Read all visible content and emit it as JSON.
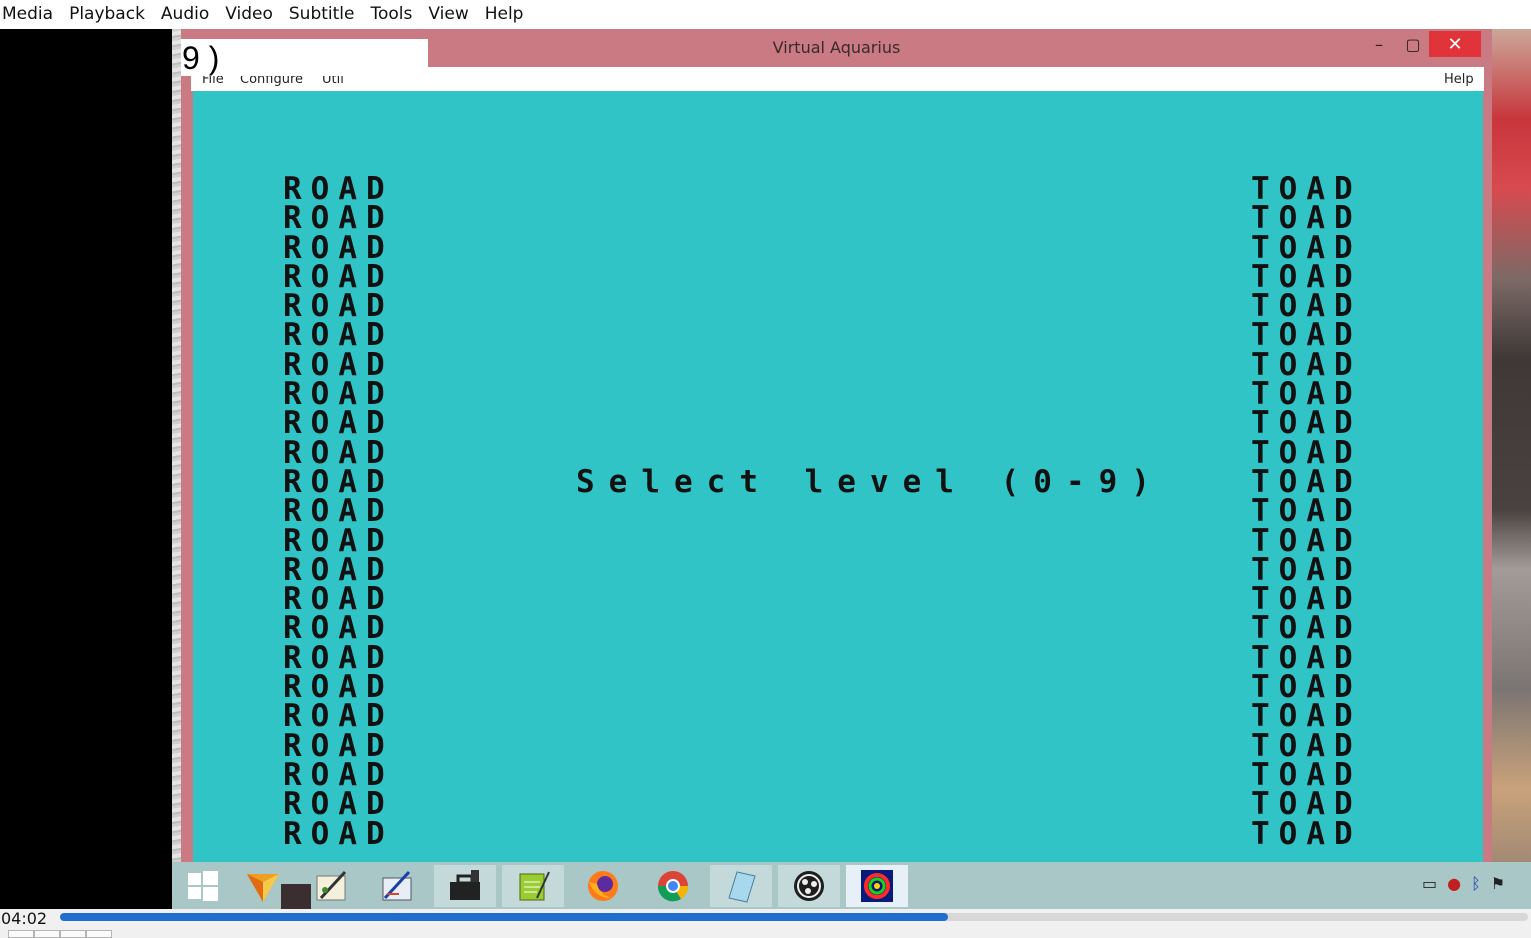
{
  "vlc": {
    "menu": [
      "Media",
      "Playback",
      "Audio",
      "Video",
      "Subtitle",
      "Tools",
      "View",
      "Help"
    ],
    "time": "04:02",
    "progress_fraction": 0.605
  },
  "emulator": {
    "title": "Virtual Aquarius",
    "controls": {
      "minimize": "–",
      "maximize": "▢",
      "close": "✕"
    },
    "menu": [
      "File",
      "Configure",
      "Util"
    ],
    "menu_help": "Help",
    "overlay_text": "9 )",
    "left_column": [
      "ROAD",
      "ROAD",
      "ROAD",
      "ROAD",
      "ROAD",
      "ROAD",
      "ROAD",
      "ROAD",
      "ROAD",
      "ROAD",
      "ROAD",
      "ROAD",
      "ROAD",
      "ROAD",
      "ROAD",
      "ROAD",
      "ROAD",
      "ROAD",
      "ROAD",
      "ROAD",
      "ROAD",
      "ROAD",
      "ROAD"
    ],
    "right_column": [
      "TOAD",
      "TOAD",
      "TOAD",
      "TOAD",
      "TOAD",
      "TOAD",
      "TOAD",
      "TOAD",
      "TOAD",
      "TOAD",
      "TOAD",
      "TOAD",
      "TOAD",
      "TOAD",
      "TOAD",
      "TOAD",
      "TOAD",
      "TOAD",
      "TOAD",
      "TOAD",
      "TOAD",
      "TOAD",
      "TOAD"
    ],
    "prompt": "Select level (0-9)",
    "screen_color": "#30c4c6"
  },
  "taskbar": {
    "icons": [
      "windows-start-icon",
      "origami-icon",
      "paint-icon",
      "pen-tablet-icon",
      "toolbox-icon",
      "notepad-icon",
      "firefox-icon",
      "chrome-icon",
      "notes-icon",
      "obs-icon",
      "quake-icon"
    ],
    "tray_icons": [
      "battery-icon",
      "speaker-icon",
      "bluetooth-icon",
      "flag-icon"
    ]
  }
}
